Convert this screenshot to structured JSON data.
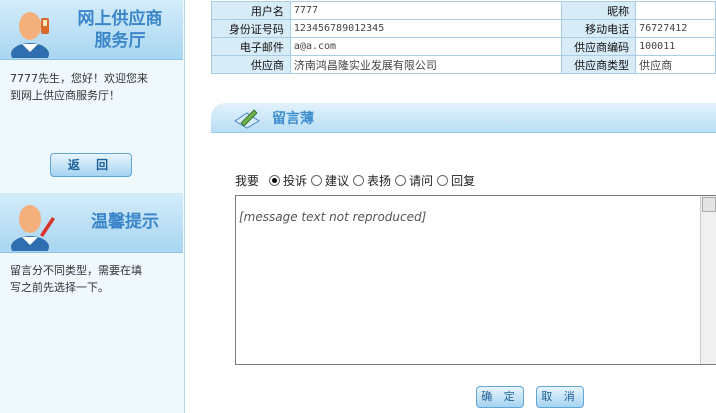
{
  "sidebar": {
    "banner1_title_line1": "网上供应商",
    "banner1_title_line2": "服务厅",
    "welcome_line1": "7777先生，您好！欢迎您来",
    "welcome_line2": "到网上供应商服务厅！",
    "back_label": "返 回",
    "banner2_title": "温馨提示",
    "tip_line1": "留言分不同类型，需要在填",
    "tip_line2": "写之前先选择一下。"
  },
  "info": {
    "username_label": "用户名",
    "username": "7777",
    "nickname_label": "昵称",
    "nickname": "",
    "idcard_label": "身份证号码",
    "idcard": "123456789012345",
    "mobile_label": "移动电话",
    "mobile": "76727412",
    "email_label": "电子邮件",
    "email": "a@a.com",
    "supplier_code_label": "供应商编码",
    "supplier_code": "100011",
    "supplier_label": "供应商",
    "supplier": "济南鸿昌隆实业发展有限公司",
    "supplier_type_label": "供应商类型",
    "supplier_type": "供应商"
  },
  "board": {
    "title": "留言薄",
    "type_label": "我要",
    "options": [
      "投诉",
      "建议",
      "表扬",
      "请问",
      "回复"
    ],
    "selected_index": 0,
    "message_text": "[message text not reproduced]",
    "ok_label": "确 定",
    "cancel_label": "取 消"
  }
}
